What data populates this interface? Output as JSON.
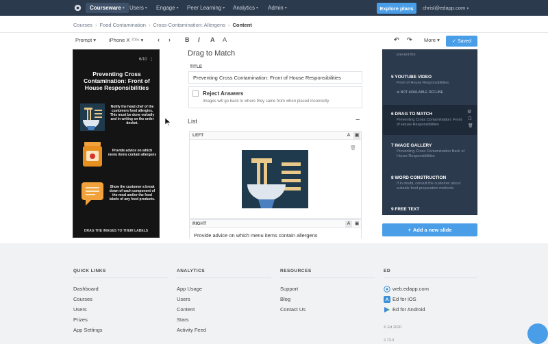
{
  "topnav": {
    "items": [
      {
        "label": "Courseware"
      },
      {
        "label": "Users"
      },
      {
        "label": "Engage"
      },
      {
        "label": "Peer Learning"
      },
      {
        "label": "Analytics"
      },
      {
        "label": "Admin"
      }
    ],
    "explore_label": "Explore plans",
    "user_email": "chrisl@edapp.com"
  },
  "breadcrumb": [
    "Courses",
    "Food Contamination",
    "Cross-Contamination: Allergens",
    "Content"
  ],
  "toolbar": {
    "prompt_label": "Prompt",
    "device_label": "iPhone X",
    "zoom": "70%",
    "more_label": "More",
    "saved_label": "Saved"
  },
  "phone": {
    "counter": "6/10",
    "title": "Preventing Cross Contamination: Front of House Responsibilities",
    "items": [
      {
        "text": "Notify the head chef of the customers food allergies. This must be done verbally and in writing on the order docket."
      },
      {
        "text": "Provide advice on which menu items contain allergens"
      },
      {
        "text": "Show the customer a break down of each component of the meal and/or the food labels of any food products."
      }
    ],
    "bottom": "DRAG THE IMAGES TO THEIR LABELS"
  },
  "editor": {
    "heading": "Drag to Match",
    "title_label": "TITLE",
    "title_value": "Preventing Cross Contamination: Front of House Responsibilities",
    "reject_label": "Reject Answers",
    "reject_help": "Images will go back to where they came from when placed incorrectly",
    "list_label": "List",
    "left_label": "LEFT",
    "right_label": "RIGHT",
    "right_value": "Provide advice on which menu items contain allergens"
  },
  "slides": [
    {
      "title": "",
      "sub": "prevent the"
    },
    {
      "title": "5  YOUTUBE VIDEO",
      "sub": "Front of House Responsibilities",
      "extra": "NOT AVAILABLE OFFLINE"
    },
    {
      "title": "6  DRAG TO MATCH",
      "sub": "Preventing Cross Contamination: Front of House Responsibilities"
    },
    {
      "title": "7  IMAGE GALLERY",
      "sub": "Preventing Cross Contamination Back of House Responsibilities"
    },
    {
      "title": "8  WORD CONSTRUCTION",
      "sub": "If in doubt, consult the customer about suitable food preparation methods"
    },
    {
      "title": "9  FREE TEXT",
      "sub": ""
    }
  ],
  "add_slide_label": "Add a new slide",
  "footer": {
    "quick_links": {
      "heading": "QUICK LINKS",
      "links": [
        "Dashboard",
        "Courses",
        "Users",
        "Prizes",
        "App Settings"
      ]
    },
    "analytics": {
      "heading": "ANALYTICS",
      "links": [
        "App Usage",
        "Users",
        "Content",
        "Stars",
        "Activity Feed"
      ]
    },
    "resources": {
      "heading": "RESOURCES",
      "links": [
        "Support",
        "Blog",
        "Contact Us"
      ]
    },
    "ed": {
      "heading": "ED",
      "links": [
        "web.edapp.com",
        "Ed for iOS",
        "Ed for Android"
      ]
    },
    "copyright": "© Ed 2020",
    "version": "2.73.0"
  }
}
